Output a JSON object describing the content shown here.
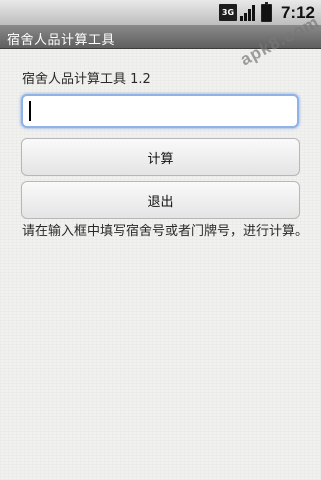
{
  "status_bar": {
    "network": "3G",
    "time": "7:12",
    "icons": [
      "network-3g-icon",
      "signal-icon",
      "battery-icon"
    ]
  },
  "watermark": "apk8.com",
  "title_bar": {
    "title": "宿舍人品计算工具"
  },
  "main": {
    "header": "宿舍人品计算工具 1.2",
    "input": {
      "value": "",
      "placeholder": ""
    },
    "calculate_label": "计算",
    "exit_label": "退出",
    "hint": "请在输入框中填写宿舍号或者门牌号，进行计算。"
  },
  "colors": {
    "title_bar": "#6f6f6f",
    "input_focus": "#8fb3e6",
    "background": "#f1f1ef"
  }
}
